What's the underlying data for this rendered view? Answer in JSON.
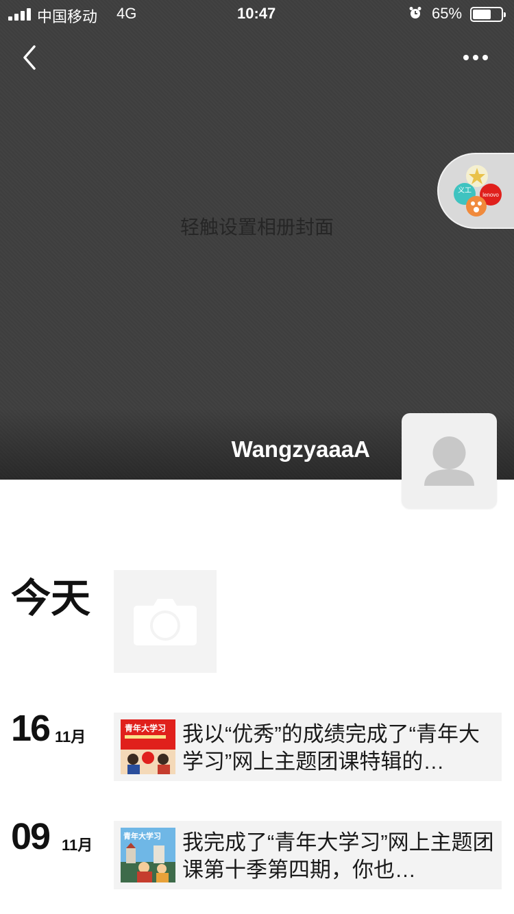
{
  "status_bar": {
    "carrier": "中国移动",
    "network": "4G",
    "time": "10:47",
    "battery_percent": "65%",
    "battery_level": 0.65
  },
  "header": {
    "back_icon": "chevron-left-icon",
    "more_icon": "more-dots-icon"
  },
  "cover": {
    "hint": "轻触设置相册封面"
  },
  "floating_badge": {
    "thumb_texts": [
      "义工",
      "lenovo"
    ]
  },
  "profile": {
    "nickname": "WangzyaaaA",
    "avatar_icon": "default-user-avatar-icon"
  },
  "today": {
    "label": "今天",
    "camera_icon": "camera-icon"
  },
  "posts": [
    {
      "day": "16",
      "month": "11月",
      "text": "我以“优秀”的成绩完成了“青年大学习”网上主题团课特辑的…",
      "thumb_text": "青年大学习"
    },
    {
      "day": "09",
      "month": "11月",
      "text": "我完成了“青年大学习”网上主题团课第十季第四期，你也…",
      "thumb_text": "青年大学习"
    }
  ],
  "colors": {
    "cover_bg": "#3f3f3f",
    "card_bg": "#f3f3f3",
    "red": "#e0201c",
    "teal": "#3fc3c0",
    "orange": "#f08a3c"
  }
}
